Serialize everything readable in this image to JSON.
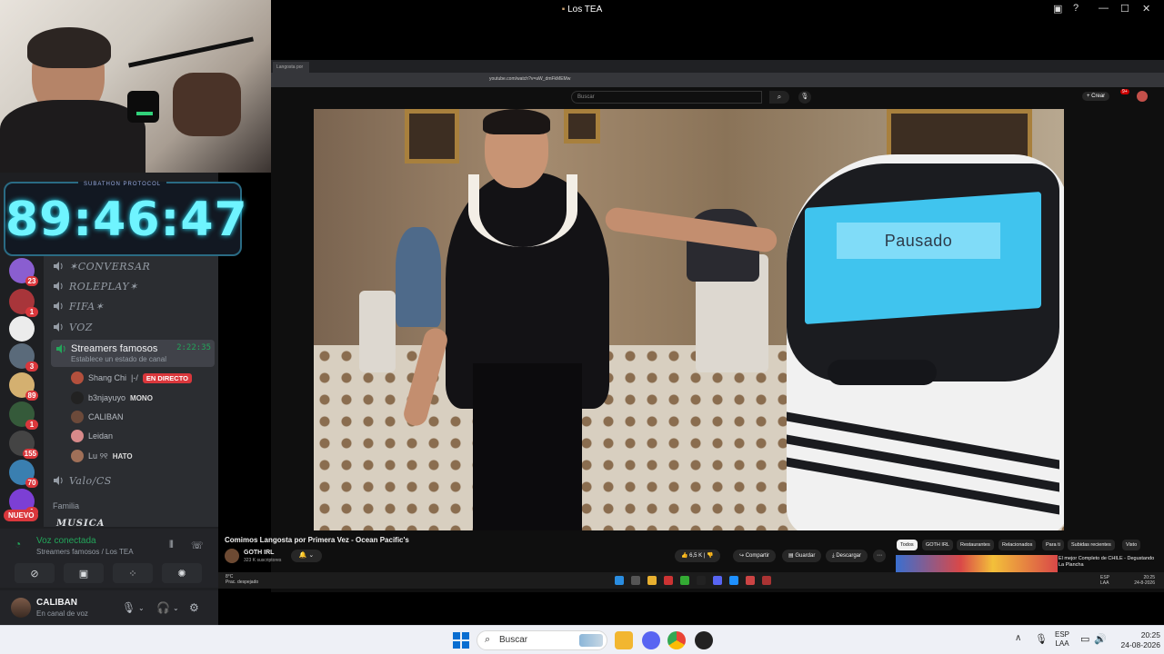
{
  "window": {
    "title": "Los TEA"
  },
  "timer": {
    "tag": "SUBATHON PROTOCOL",
    "value": "89:46:47"
  },
  "discord": {
    "server_badges": [
      "23",
      "1",
      "",
      "3",
      "89",
      "1",
      "155",
      "70",
      "1"
    ],
    "new_label": "NUEVO",
    "channels": [
      {
        "name": "✶CONVERSAR"
      },
      {
        "name": "ROLEPLAY✶"
      },
      {
        "name": "FIFA✶"
      },
      {
        "name": "VOZ"
      }
    ],
    "active_voice": {
      "name": "Streamers famosos",
      "time": "2:22:35",
      "status": "Establece un estado de canal"
    },
    "voice_users": [
      {
        "name": "Shang Chi",
        "extra": "|-/",
        "badge": "EN DIRECTO",
        "color": "#b3503d"
      },
      {
        "name": "b3njayuyo",
        "extra": "",
        "badge": "MONO",
        "color": "#222222"
      },
      {
        "name": "CALIBAN",
        "extra": "",
        "badge": "",
        "color": "#6c4a3a"
      },
      {
        "name": "Leidan",
        "extra": "",
        "badge": "",
        "color": "#d88a8a"
      },
      {
        "name": "Lu ୨୧",
        "extra": "",
        "badge": "HATO",
        "color": "#a07058"
      }
    ],
    "channel_valo": "Valo/CS",
    "category_familia": "Familia",
    "channel_musica": "MUSICA",
    "voice_panel": {
      "title": "Voz conectada",
      "subtitle": "Streamers famosos / Los TEA"
    },
    "user_panel": {
      "name": "CALIBAN",
      "status": "En canal de voz"
    }
  },
  "browser": {
    "tab_label": "Langosta por",
    "url": "youtube.com/watch?v=aW_dmFkMEMw",
    "search_placeholder": "Buscar",
    "create_label": "+ Crear",
    "notif_count": "9+"
  },
  "video": {
    "paused_text": "Pausado",
    "title": "Comimos Langosta por Primera Vez - Ocean Pacific's",
    "channel": "GOTH IRL",
    "subscribers": "323 K suscriptores",
    "likes": "6,5 K",
    "actions": [
      "Compartir",
      "Guardar",
      "Descargar"
    ],
    "chips": [
      "Todos",
      "GOTH IRL",
      "Restaurantes",
      "Relacionados",
      "Para ti",
      "Subidas recientes",
      "Visto"
    ],
    "rec_title": "El mejor Completo de CHILE - Degustando La Plancha"
  },
  "inner_taskbar": {
    "weather": "8°C",
    "weather_desc": "Prac. despejado",
    "lang_top": "ESP",
    "lang_bottom": "LAA",
    "time": "20:25",
    "date": "24-8-2026"
  },
  "taskbar": {
    "search_placeholder": "Buscar",
    "lang_top": "ESP",
    "lang_bottom": "LAA",
    "time": "20:25",
    "date": "24-08-2026"
  }
}
